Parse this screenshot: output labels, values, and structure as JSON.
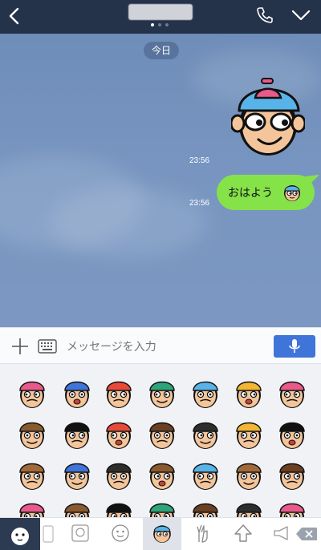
{
  "header": {
    "back_icon": "chevron-left-icon",
    "call_icon": "phone-icon",
    "menu_icon": "chevron-down-icon",
    "page_dots": 3,
    "active_dot": 0
  },
  "chat": {
    "date_label": "今日",
    "messages": [
      {
        "type": "sticker",
        "time": "23:56"
      },
      {
        "type": "text",
        "text": "おはよう",
        "time": "23:56"
      }
    ]
  },
  "input": {
    "placeholder": "メッセージを入力",
    "plus_icon": "plus-icon",
    "keyboard_icon": "keyboard-icon",
    "mic_icon": "microphone-icon"
  },
  "sticker_panel": {
    "rows": 4,
    "cols": 7
  },
  "colors": {
    "header_bg": "#24324a",
    "bubble": "#85e249",
    "accent": "#3f74d8"
  }
}
